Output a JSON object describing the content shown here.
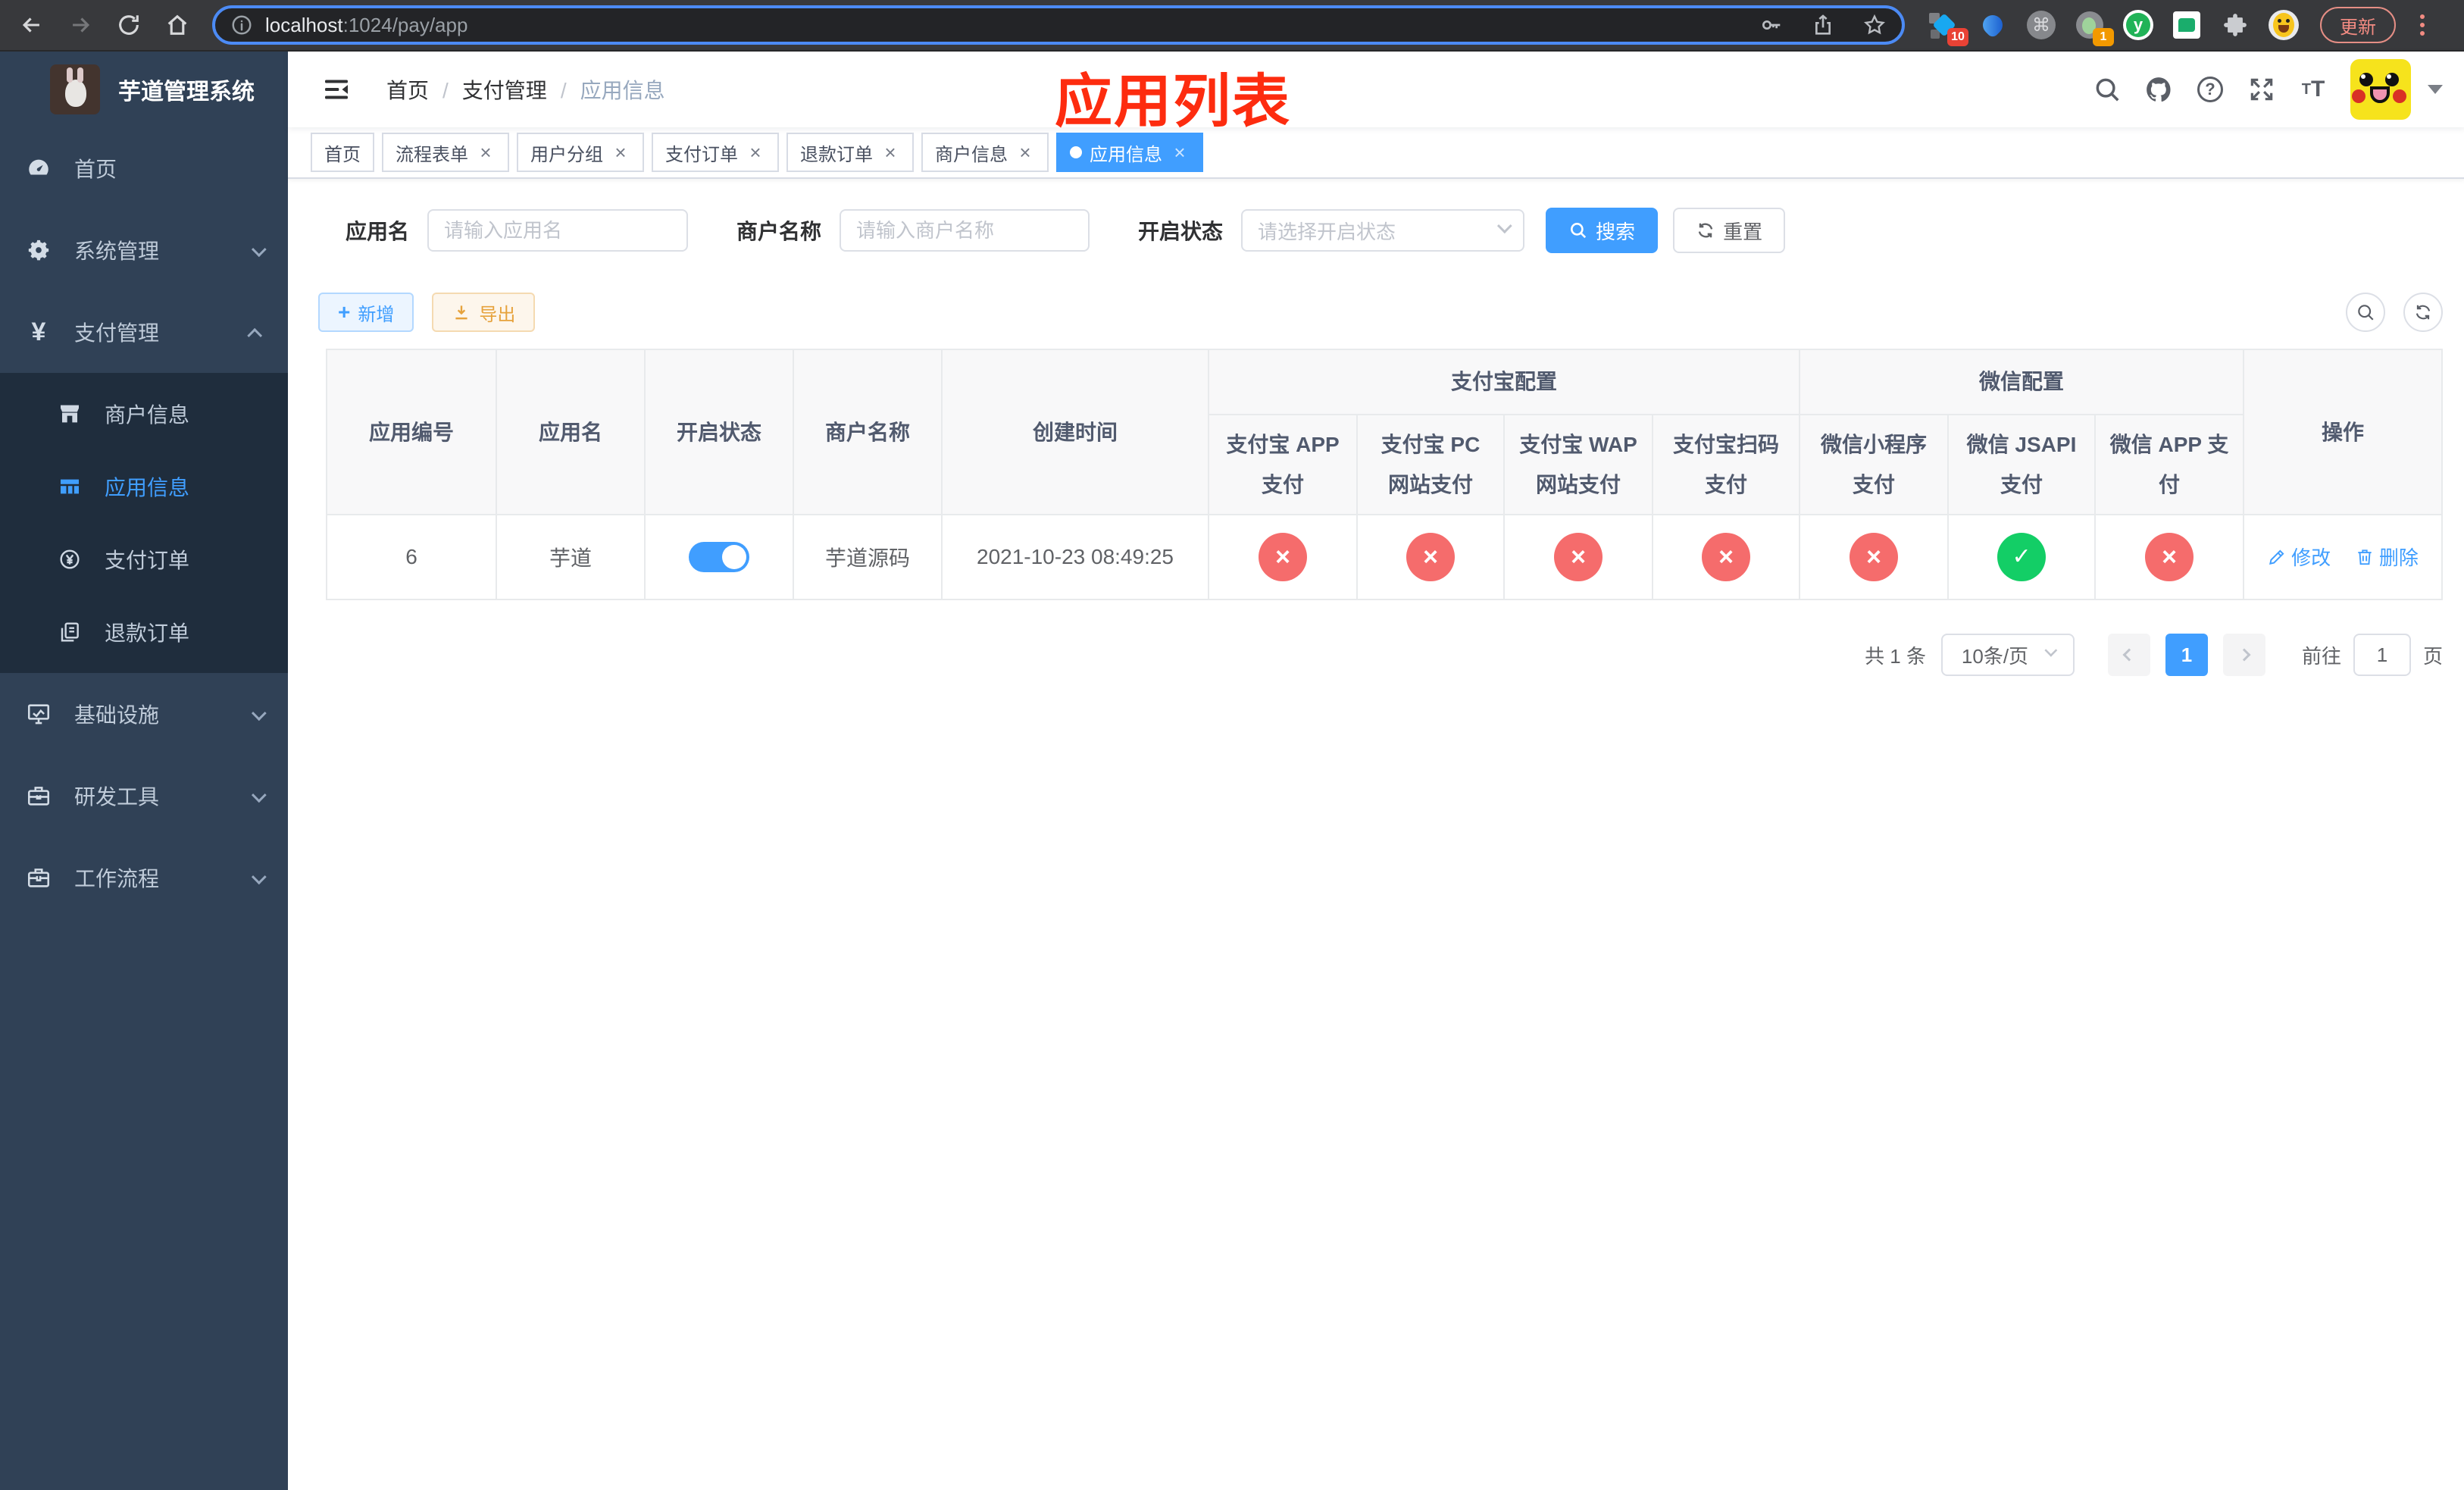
{
  "browser": {
    "url": {
      "host": "localhost",
      "rest": ":1024/pay/app"
    },
    "extensions": {
      "diamond_badge": "10",
      "camera_badge": "1",
      "command_glyph": "⌘",
      "y_glyph": "y"
    },
    "update_button": "更新"
  },
  "sidebar": {
    "app_title": "芋道管理系统",
    "menu": [
      {
        "label": "首页"
      },
      {
        "label": "系统管理"
      },
      {
        "label": "支付管理"
      },
      {
        "label": "基础设施"
      },
      {
        "label": "研发工具"
      },
      {
        "label": "工作流程"
      }
    ],
    "submenu_pay": [
      {
        "label": "商户信息"
      },
      {
        "label": "应用信息"
      },
      {
        "label": "支付订单"
      },
      {
        "label": "退款订单"
      }
    ],
    "yen_glyph": "¥"
  },
  "navbar": {
    "breadcrumb": [
      {
        "label": "首页"
      },
      {
        "label": "支付管理"
      },
      {
        "label": "应用信息"
      }
    ],
    "annotation": "应用列表"
  },
  "tags_view": [
    {
      "label": "首页"
    },
    {
      "label": "流程表单"
    },
    {
      "label": "用户分组"
    },
    {
      "label": "支付订单"
    },
    {
      "label": "退款订单"
    },
    {
      "label": "商户信息"
    },
    {
      "label": "应用信息"
    }
  ],
  "filters": {
    "app_name_label": "应用名",
    "app_name_placeholder": "请输入应用名",
    "merchant_label": "商户名称",
    "merchant_placeholder": "请输入商户名称",
    "status_label": "开启状态",
    "status_placeholder": "请选择开启状态",
    "search_button": "搜索",
    "reset_button": "重置"
  },
  "toolbar": {
    "add_button": "新增",
    "export_button": "导出"
  },
  "table": {
    "columns": [
      "应用编号",
      "应用名",
      "开启状态",
      "商户名称",
      "创建时间"
    ],
    "groups": {
      "alipay": {
        "label": "支付宝配置",
        "children": [
          "支付宝 APP 支付",
          "支付宝 PC 网站支付",
          "支付宝 WAP 网站支付",
          "支付宝扫码支付"
        ]
      },
      "wechat": {
        "label": "微信配置",
        "children": [
          "微信小程序支付",
          "微信 JSAPI 支付",
          "微信 APP 支付"
        ]
      },
      "ops": "操作"
    },
    "rows": [
      {
        "app_id": "6",
        "app_name": "芋道",
        "enabled": true,
        "merchant_name": "芋道源码",
        "create_time": "2021-10-23 08:49:25",
        "alipay_app": "no",
        "alipay_pc": "no",
        "alipay_wap": "no",
        "alipay_scan": "no",
        "wx_lite": "no",
        "wx_jsapi": "yes",
        "wx_app": "no",
        "action_edit": "修改",
        "action_delete": "删除"
      }
    ]
  },
  "pagination": {
    "total_text": "共 1 条",
    "page_size_text": "10条/页",
    "page": "1",
    "goto_prefix": "前往",
    "goto_value": "1",
    "goto_suffix": "页"
  },
  "colors": {
    "primary": "#409eff",
    "danger": "#f56c6c",
    "success": "#13ce66",
    "warning": "#e6a23c",
    "sidebar_bg": "#304156",
    "submenu_bg": "#1f2d3d",
    "annotation_red": "#fd2c0f"
  }
}
